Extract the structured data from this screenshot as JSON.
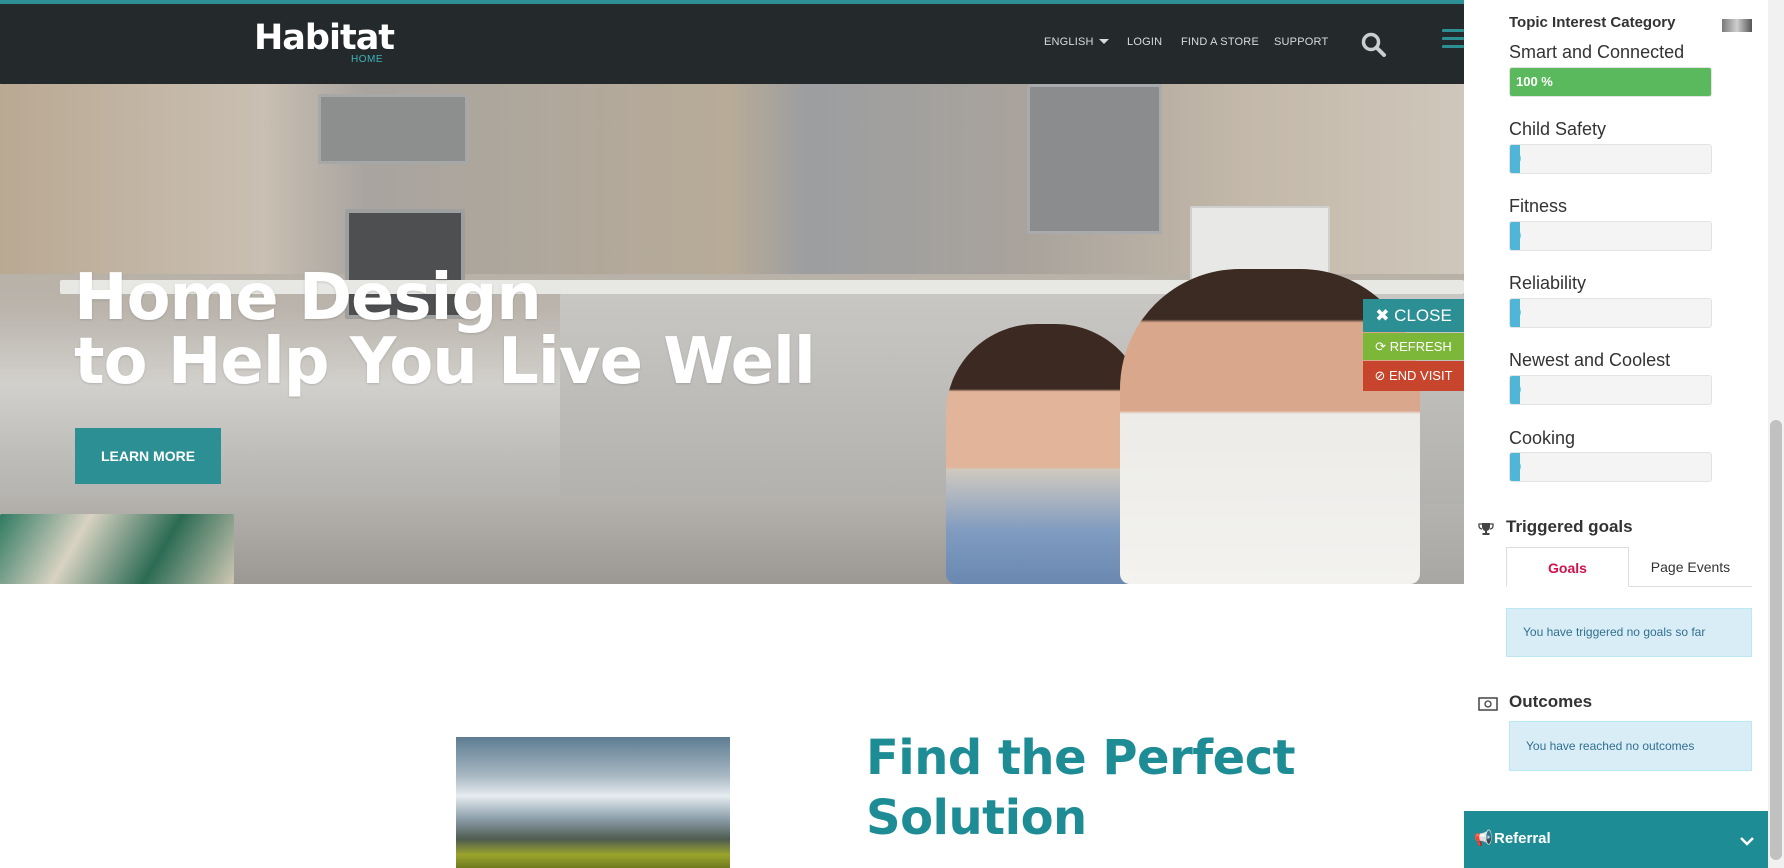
{
  "header": {
    "logo_text": "Habitat",
    "logo_sub": "HOME",
    "nav": [
      {
        "label": "ENGLISH"
      },
      {
        "label": "LOGIN"
      },
      {
        "label": "FIND A STORE"
      },
      {
        "label": "SUPPORT"
      }
    ]
  },
  "hero": {
    "title_line1": "Home Design",
    "title_line2": "to Help You Live Well",
    "cta_label": "LEARN MORE"
  },
  "controls": {
    "close_label": "CLOSE",
    "refresh_label": "REFRESH",
    "end_visit_label": "END VISIT"
  },
  "section": {
    "title_line1": "Find the Perfect",
    "title_line2": "Solution"
  },
  "panel": {
    "heading": "Topic Interest Category",
    "topics": [
      {
        "label": "Smart and Connected",
        "percent": 100,
        "value_text": "100 %"
      },
      {
        "label": "Child Safety",
        "percent": 0,
        "value_text": "0"
      },
      {
        "label": "Fitness",
        "percent": 0,
        "value_text": "0"
      },
      {
        "label": "Reliability",
        "percent": 0,
        "value_text": "0"
      },
      {
        "label": "Newest and Coolest",
        "percent": 0,
        "value_text": "0"
      },
      {
        "label": "Cooking",
        "percent": 0,
        "value_text": "0"
      }
    ],
    "triggered_goals": {
      "heading": "Triggered goals",
      "tabs": [
        {
          "label": "Goals"
        },
        {
          "label": "Page Events"
        }
      ],
      "message": "You have triggered no goals so far"
    },
    "outcomes": {
      "heading": "Outcomes",
      "message": "You have reached no outcomes"
    },
    "referral": {
      "label": "Referral"
    }
  },
  "colors": {
    "teal": "#2b8f94",
    "header_bg": "#242a2b",
    "progress_green": "#5bb95d",
    "refresh_green": "#7db73a",
    "end_visit_red": "#c6452c",
    "goals_tab_red": "#d0114c"
  }
}
